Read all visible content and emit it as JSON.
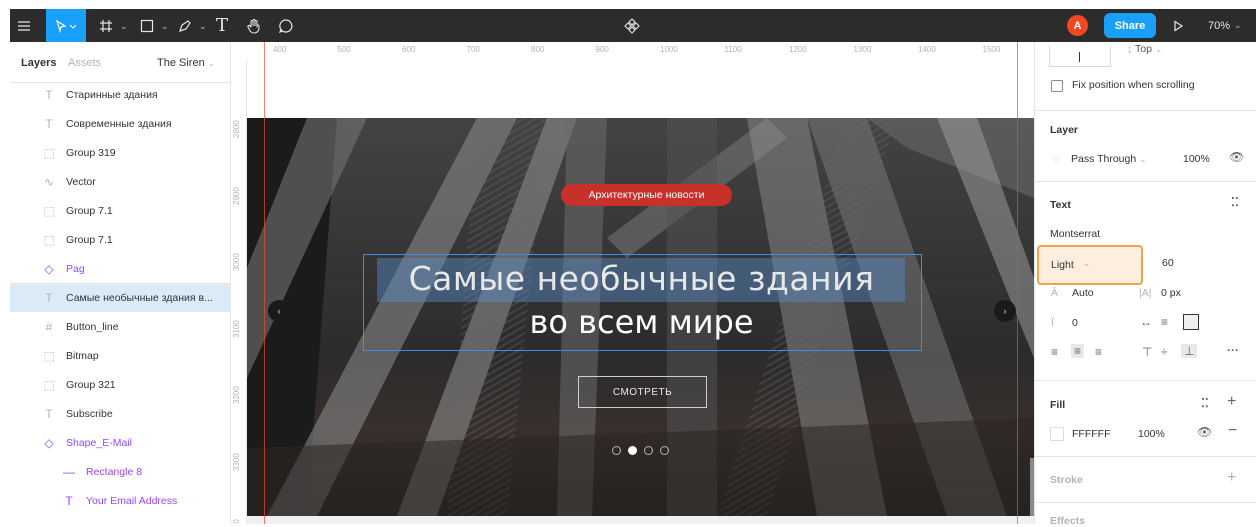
{
  "toolbar": {
    "icons": [
      "menu-icon",
      "move-icon",
      "frame-icon",
      "shape-icon",
      "pen-icon",
      "text-icon",
      "hand-icon",
      "comment-icon",
      "component-icon",
      "play-icon"
    ],
    "avatar_letter": "A",
    "share_label": "Share",
    "zoom_label": "70%",
    "accent": "#18a0fb"
  },
  "left_panel": {
    "tab_layers": "Layers",
    "tab_assets": "Assets",
    "page_name": "The Siren",
    "layers": [
      {
        "icon": "T",
        "label": "Старинные здания"
      },
      {
        "icon": "T",
        "label": "Современные здания"
      },
      {
        "icon": "⬚",
        "label": "Group 319"
      },
      {
        "icon": "∿",
        "label": "Vector"
      },
      {
        "icon": "⬚",
        "label": "Group 7.1"
      },
      {
        "icon": "⬚",
        "label": "Group 7.1"
      },
      {
        "icon": "◇",
        "label": "Pag"
      },
      {
        "icon": "T",
        "label": "Самые необычные здания в..."
      },
      {
        "icon": "#",
        "label": "Button_line"
      },
      {
        "icon": "⬚",
        "label": "Bitmap"
      },
      {
        "icon": "⬚",
        "label": "Group 321"
      },
      {
        "icon": "T",
        "label": "Subscribe"
      },
      {
        "icon": "◇",
        "label": "Shape_E-Mail"
      },
      {
        "icon": "—",
        "label": "Rectangle 8"
      },
      {
        "icon": "T",
        "label": "Your Email Address"
      }
    ]
  },
  "canvas": {
    "ruler_top": [
      "400",
      "500",
      "600",
      "700",
      "800",
      "900",
      "1000",
      "1100",
      "1200",
      "1300",
      "1400",
      "1500"
    ],
    "ruler_left": [
      "2800",
      "2900",
      "3000",
      "3100",
      "3200",
      "3300",
      "3400"
    ],
    "badge": "Архитектурные новости",
    "title_line1": "Самые необычные здания",
    "title_line2": "во всем мире",
    "button": "СМОТРЕТЬ"
  },
  "right_panel": {
    "constraint": "Top",
    "fix_position": "Fix position when scrolling",
    "layer_heading": "Layer",
    "blend_mode": "Pass Through",
    "layer_opacity": "100%",
    "text_heading": "Text",
    "font_family": "Montserrat",
    "font_weight": "Light",
    "font_size": "60",
    "line_height": "Auto",
    "letter_spacing": "0 px",
    "paragraph_spacing": "0",
    "fill_heading": "Fill",
    "fill_hex": "FFFFFF",
    "fill_opacity": "100%",
    "stroke_heading": "Stroke",
    "effects_heading": "Effects"
  }
}
